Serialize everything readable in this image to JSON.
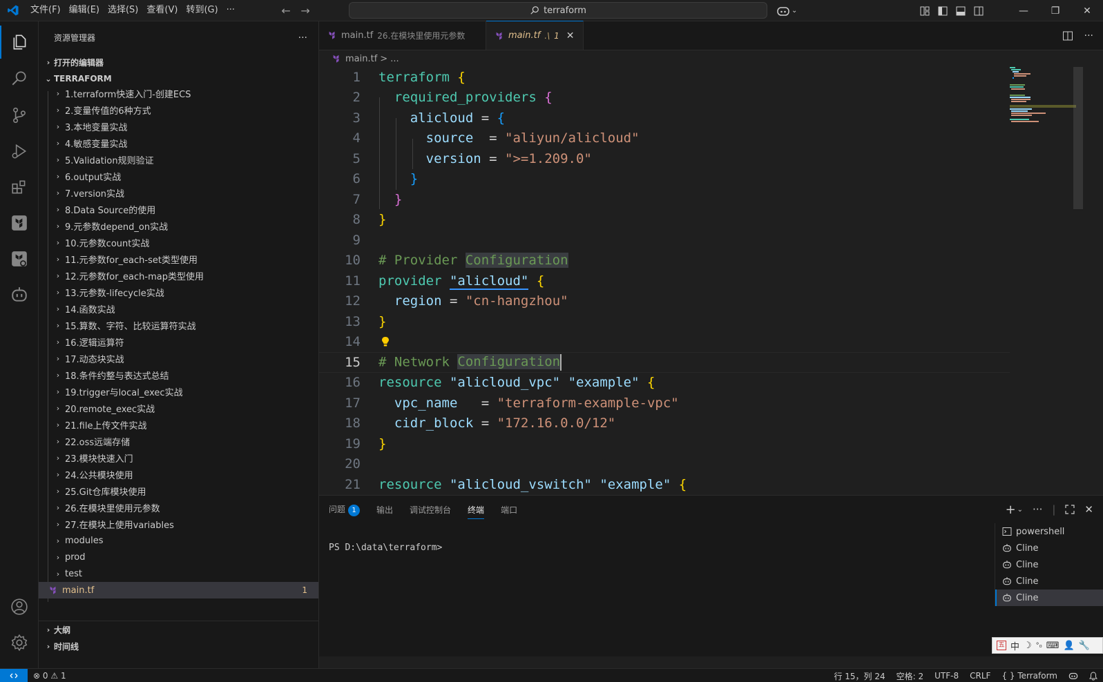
{
  "titlebar": {
    "menu": [
      "文件(F)",
      "编辑(E)",
      "选择(S)",
      "查看(V)",
      "转到(G)",
      "···"
    ],
    "search_text": "terraform",
    "brand_color": "#0078d4"
  },
  "sidebar": {
    "title": "资源管理器",
    "more": "···",
    "open_editors": "打开的编辑器",
    "folder": "TERRAFORM",
    "items": [
      "1.terraform快速入门-创建ECS",
      "2.变量传值的6种方式",
      "3.本地变量实战",
      "4.敏感变量实战",
      "5.Validation规则验证",
      "6.output实战",
      "7.version实战",
      "8.Data Source的使用",
      "9.元参数depend_on实战",
      "10.元参数count实战",
      "11.元参数for_each-set类型使用",
      "12.元参数for_each-map类型使用",
      "13.元参数-lifecycle实战",
      "14.函数实战",
      "15.算数、字符、比较运算符实战",
      "16.逻辑运算符",
      "17.动态块实战",
      "18.条件约整与表达式总结",
      "19.trigger与local_exec实战",
      "20.remote_exec实战",
      "21.file上传文件实战",
      "22.oss远端存储",
      "23.模块快速入门",
      "24.公共模块使用",
      "25.Git仓库模块使用",
      "26.在模块里使用元参数",
      "27.在模块上使用variables",
      "modules",
      "prod",
      "test"
    ],
    "selected_file": "main.tf",
    "selected_badge": "1",
    "outline": "大纲",
    "timeline": "时间线"
  },
  "tabs": [
    {
      "label": "main.tf",
      "desc": "26.在模块里使用元参数"
    },
    {
      "label": "main.tf",
      "desc": ".\\",
      "dirty": "1",
      "close": "✕"
    }
  ],
  "breadcrumb": {
    "file": "main.tf",
    "sep": ">",
    "rest": "..."
  },
  "code": {
    "line_numbers": [
      "1",
      "2",
      "3",
      "4",
      "5",
      "6",
      "7",
      "8",
      "9",
      "10",
      "11",
      "12",
      "13",
      "14",
      "15",
      "16",
      "17",
      "18",
      "19",
      "20",
      "21"
    ],
    "l1_kw": "terraform",
    "l1_b": "{",
    "l2_kw": "required_providers",
    "l2_b": "{",
    "l3_kw": "alicloud",
    "l3_eq": " = ",
    "l3_b": "{",
    "l4_prop": "source",
    "l4_eq": "  = ",
    "l4_str": "\"aliyun/alicloud\"",
    "l5_prop": "version",
    "l5_eq": " = ",
    "l5_str": "\">=1.209.0\"",
    "l6_b": "}",
    "l7_b": "}",
    "l8_b": "}",
    "l10_cmt": "# Provider ",
    "l10_hl": "Configuration",
    "l11_kw": "provider",
    "l11_str": "\"alicloud\"",
    "l11_b": "{",
    "l12_prop": "region",
    "l12_eq": " = ",
    "l12_str": "\"cn-hangzhou\"",
    "l13_b": "}",
    "l15_cmt": "# Network ",
    "l15_hl": "Configuration",
    "l16_kw": "resource",
    "l16_s1": "\"alicloud_vpc\"",
    "l16_s2": "\"example\"",
    "l16_b": "{",
    "l17_prop": "vpc_name",
    "l17_eq": "   = ",
    "l17_str": "\"terraform-example-vpc\"",
    "l18_prop": "cidr_block",
    "l18_eq": " = ",
    "l18_str": "\"172.16.0.0/12\"",
    "l19_b": "}",
    "l21_kw": "resource",
    "l21_s1": "\"alicloud_vswitch\"",
    "l21_s2": "\"example\"",
    "l21_b": "{"
  },
  "panel": {
    "tabs": [
      "问题",
      "输出",
      "调试控制台",
      "终端",
      "端口"
    ],
    "problems_badge": "1",
    "prompt": "PS D:\\data\\terraform>",
    "terminals": [
      "powershell",
      "Cline",
      "Cline",
      "Cline",
      "Cline"
    ]
  },
  "ime": {
    "cn": "中",
    "moon": "☽",
    "dots": "°₀"
  },
  "statusbar": {
    "errors": "0",
    "warnings": "1",
    "position": "行 15，列 24",
    "spaces": "空格: 2",
    "encoding": "UTF-8",
    "eol": "CRLF",
    "language": "{ } Terraform"
  }
}
